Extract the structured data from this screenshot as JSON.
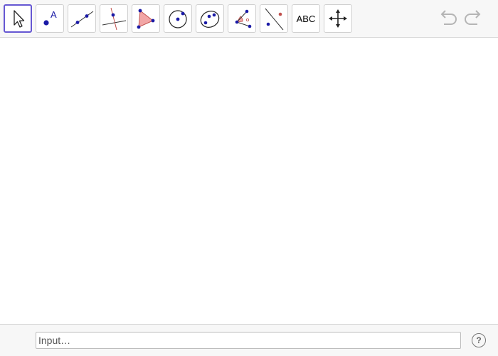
{
  "toolbar": {
    "tools": [
      {
        "name": "move",
        "icon": "move-pointer-icon",
        "active": true
      },
      {
        "name": "point",
        "icon": "point-icon",
        "label": "A"
      },
      {
        "name": "line",
        "icon": "line-icon"
      },
      {
        "name": "perpendicular-line",
        "icon": "perpendicular-line-icon"
      },
      {
        "name": "polygon",
        "icon": "polygon-icon"
      },
      {
        "name": "circle-center-point",
        "icon": "circle-center-point-icon"
      },
      {
        "name": "conic",
        "icon": "conic-ellipse-icon"
      },
      {
        "name": "angle",
        "icon": "angle-icon"
      },
      {
        "name": "reflect",
        "icon": "reflect-about-line-icon"
      },
      {
        "name": "text",
        "icon": "text-icon",
        "label": "ABC"
      },
      {
        "name": "move-graphics-view",
        "icon": "move-graphics-view-icon"
      }
    ],
    "undo_icon": "undo-icon",
    "redo_icon": "redo-icon"
  },
  "input_bar": {
    "placeholder": "Input…",
    "help_label": "?"
  },
  "colors": {
    "accent": "#6557d2",
    "point": "#1a1aa6",
    "polygon_fill": "#f2a6a6",
    "polygon_stroke": "#c0504d"
  }
}
